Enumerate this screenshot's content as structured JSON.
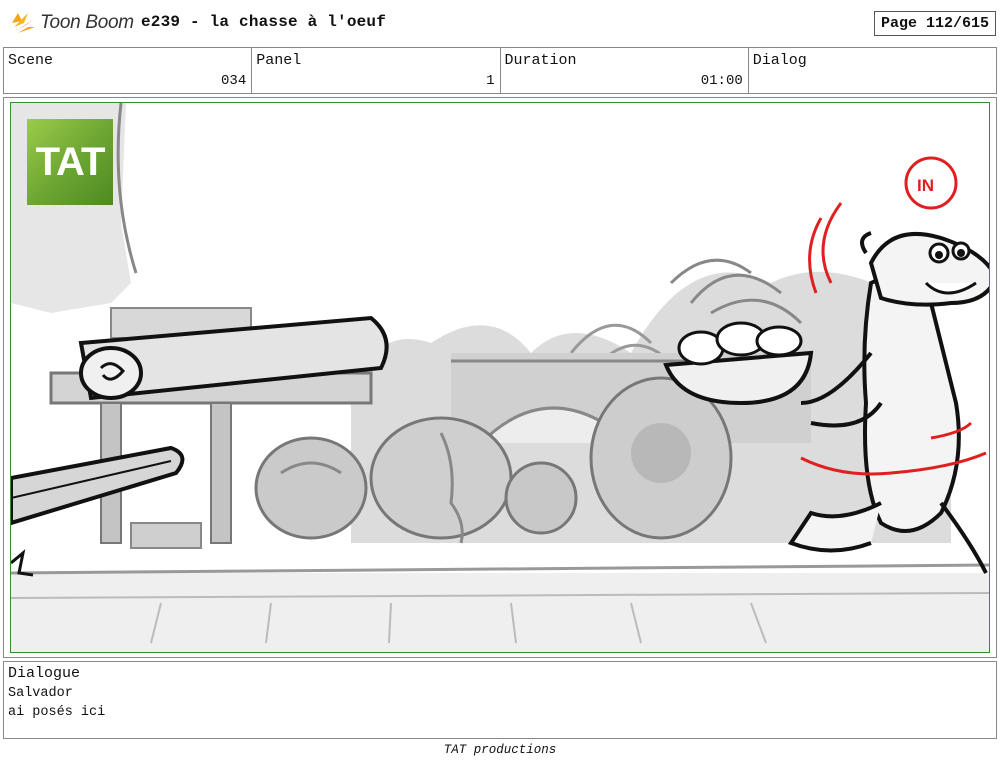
{
  "header": {
    "brand": "Toon Boom",
    "title": "e239 - la chasse à l'oeuf",
    "page": "Page 112/615"
  },
  "fields": {
    "scene": {
      "label": "Scene",
      "value": "034"
    },
    "panel": {
      "label": "Panel",
      "value": "1"
    },
    "duration": {
      "label": "Duration",
      "value": "01:00"
    },
    "dialog": {
      "label": "Dialog",
      "value": ""
    }
  },
  "panel_image": {
    "watermark": "TAT",
    "annotation": "IN",
    "annotation_color": "#e02020",
    "frame_color": "#3a8a3a"
  },
  "dialogue": {
    "title": "Dialogue",
    "lines": [
      "Salvador",
      "ai posés ici"
    ]
  },
  "footer": "TAT productions"
}
